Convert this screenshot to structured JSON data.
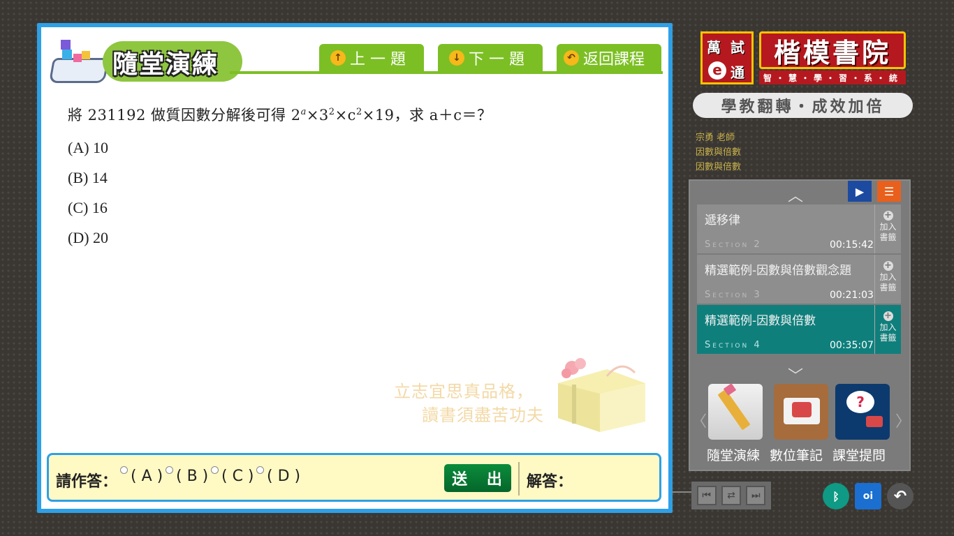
{
  "header": {
    "title": "隨堂演練",
    "prev_label": "上 一 題",
    "next_label": "下 一 題",
    "back_label": "返回課程"
  },
  "question": {
    "text_before": "將 231192 做質因數分解後可得 2",
    "exp_a": "a",
    "text_mid1": "×3",
    "exp_2a": "2",
    "text_mid2": "×c",
    "exp_2b": "2",
    "text_after": "×19，求 a＋c＝？",
    "options": [
      "(A) 10",
      "(B) 14",
      "(C) 16",
      "(D) 20"
    ]
  },
  "motto": {
    "line1": "立志宜思真品格，",
    "line2": "讀書須盡苦功夫"
  },
  "answer": {
    "prompt": "請作答：",
    "choices": [
      "( A )",
      "( B )",
      "( C )",
      "( D )"
    ],
    "submit_label": "送 出",
    "solution_label": "解答："
  },
  "brand": {
    "badge_chars": [
      "萬",
      "試",
      "e",
      "通"
    ],
    "name": "楷模書院",
    "tagline": "智・慧・學・習・系・統",
    "slogan": "學教翻轉・成效加倍"
  },
  "course": {
    "teacher": "宗勇 老師",
    "subject": "因數與倍數",
    "chapter": "因數與倍數"
  },
  "playlist": {
    "items": [
      {
        "title": "遞移律",
        "section": "Section 2",
        "duration": "00:15:42",
        "bookmark": "加入書籤",
        "active": false
      },
      {
        "title": "精選範例-因數與倍數觀念題",
        "section": "Section 3",
        "duration": "00:21:03",
        "bookmark": "加入書籤",
        "active": false
      },
      {
        "title": "精選範例-因數與倍數",
        "section": "Section 4",
        "duration": "00:35:07",
        "bookmark": "加入書籤",
        "active": true
      }
    ]
  },
  "tools": {
    "practice": "隨堂演練",
    "notes": "數位筆記",
    "ask": "課堂提問"
  },
  "colors": {
    "accent_blue": "#2ea0e6",
    "accent_green": "#7cbf24",
    "active_teal": "#0f7f7c",
    "brand_red": "#b5191f"
  }
}
